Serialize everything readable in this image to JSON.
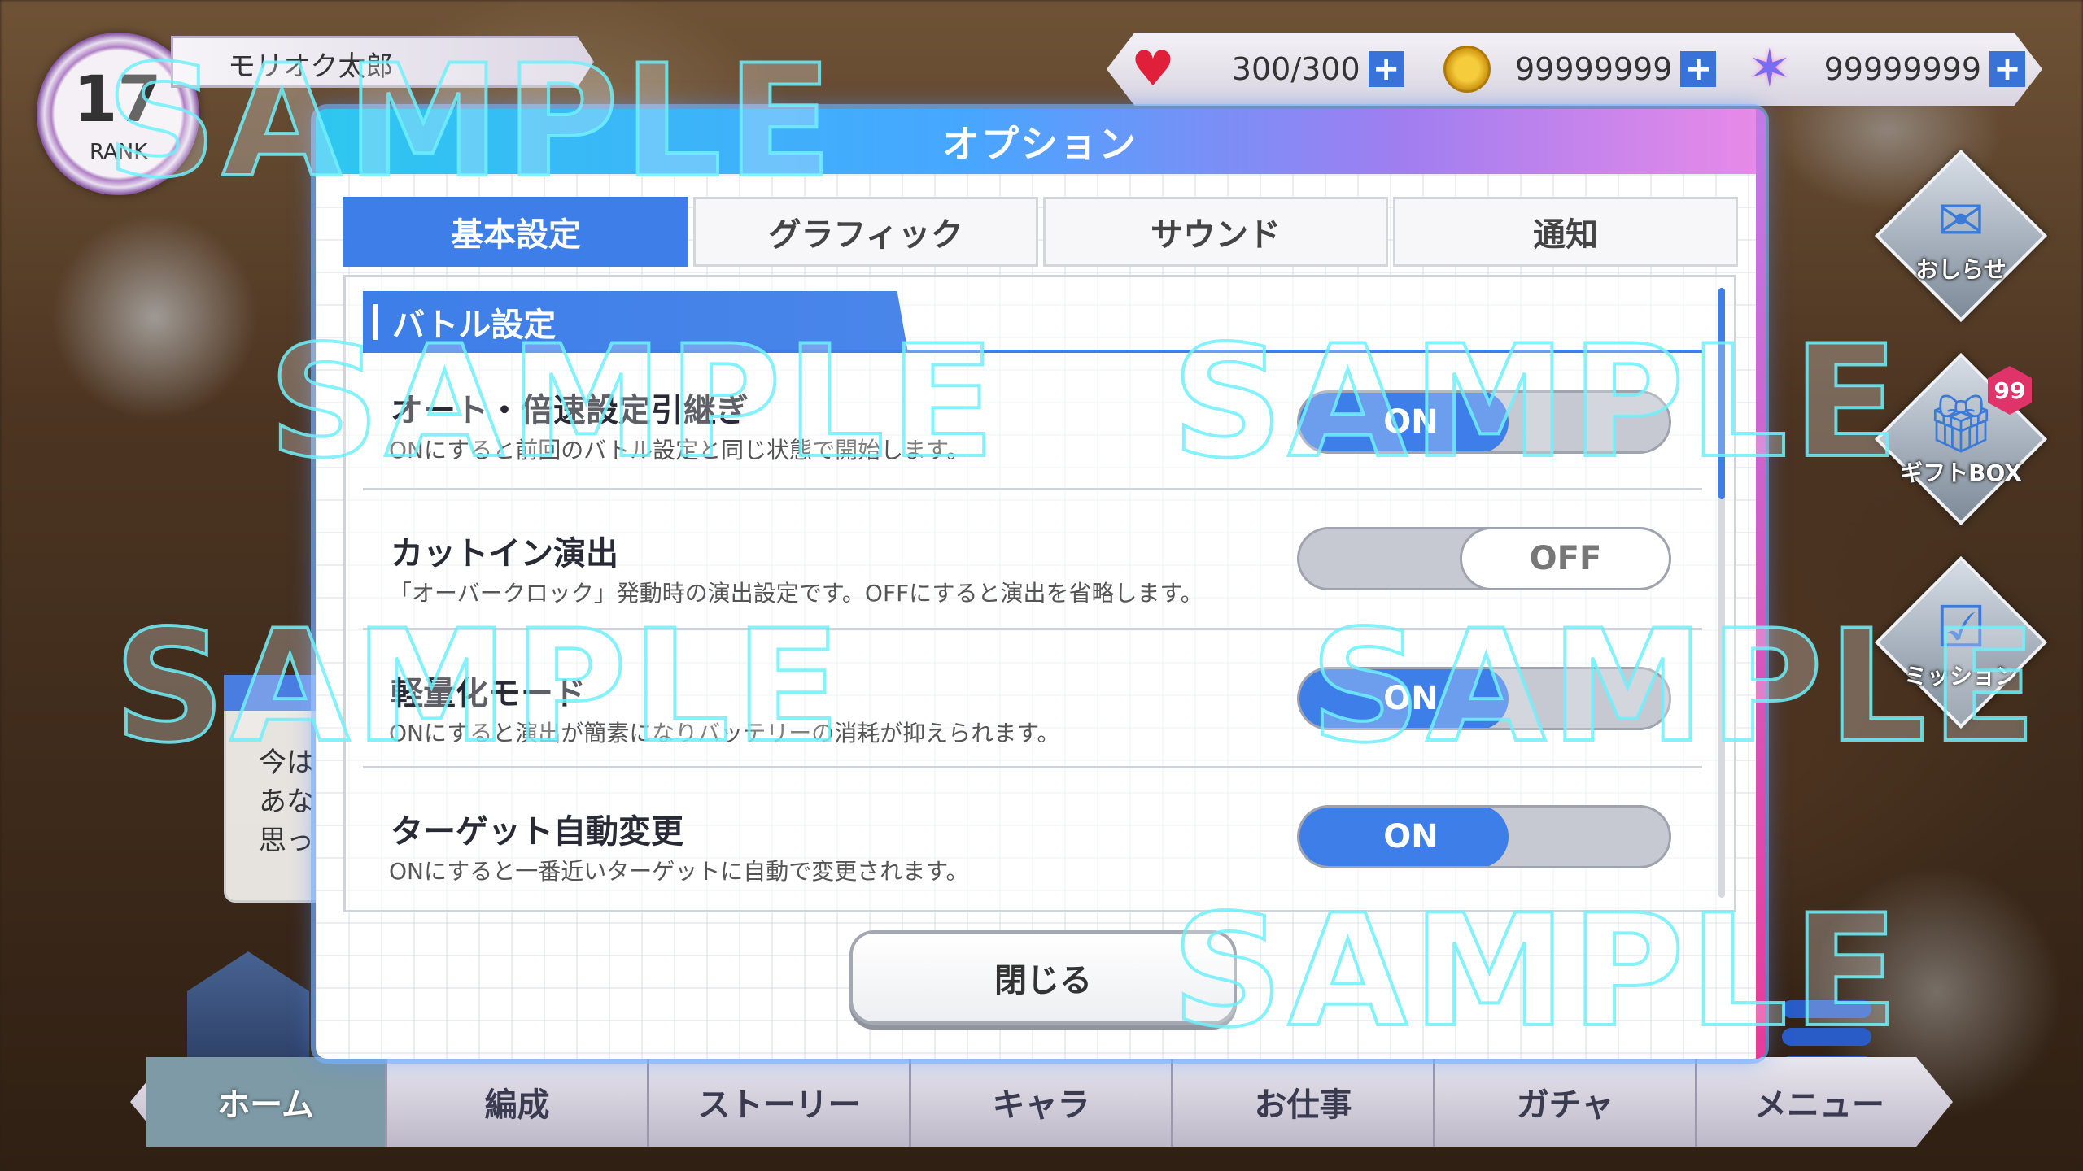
{
  "player": {
    "rank_number": "17",
    "rank_label": "RANK",
    "name": "モリオク太郎"
  },
  "currency": {
    "stamina": "300/300",
    "coins": "99999999",
    "gems": "99999999",
    "plus_label": "+"
  },
  "side_buttons": {
    "news_label": "おしらせ",
    "gift_label": "ギフトBOX",
    "gift_badge": "99",
    "mission_label": "ミッション"
  },
  "left_panel": {
    "lines": [
      "今は",
      "あな",
      "思っ"
    ]
  },
  "bottom_nav": [
    {
      "label": "ホーム"
    },
    {
      "label": "編成"
    },
    {
      "label": "ストーリー"
    },
    {
      "label": "キャラ"
    },
    {
      "label": "お仕事"
    },
    {
      "label": "ガチャ"
    },
    {
      "label": "メニュー"
    }
  ],
  "modal": {
    "title": "オプション",
    "tabs": [
      {
        "label": "基本設定"
      },
      {
        "label": "グラフィック"
      },
      {
        "label": "サウンド"
      },
      {
        "label": "通知"
      }
    ],
    "section_title": "バトル設定",
    "settings": [
      {
        "title": "オート・倍速設定引継ぎ",
        "desc": "ONにすると前回のバトル設定と同じ状態で開始します。",
        "state": "ON"
      },
      {
        "title": "カットイン演出",
        "desc": "「オーバークロック」発動時の演出設定です。OFFにすると演出を省略します。",
        "state": "OFF"
      },
      {
        "title": "軽量化モード",
        "desc": "ONにすると演出が簡素になりバッテリーの消耗が抑えられます。",
        "state": "ON"
      },
      {
        "title": "ターゲット自動変更",
        "desc": "ONにすると一番近いターゲットに自動で変更されます。",
        "state": "ON"
      }
    ],
    "close_label": "閉じる"
  },
  "watermark": "SAMPLE",
  "colors": {
    "accent_blue": "#3d7ee8",
    "title_gradient_start": "#2ec7f0",
    "title_gradient_end": "#e98ae8",
    "heart": "#e0203a",
    "badge": "#e0336a"
  },
  "icons": {
    "heart": "heart-icon",
    "coin": "coin-icon",
    "star": "star-gem-icon",
    "news": "envelope-icon",
    "gift": "gift-icon",
    "mission": "clipboard-icon",
    "home": "building-icon",
    "menu": "menu-lines-icon"
  }
}
